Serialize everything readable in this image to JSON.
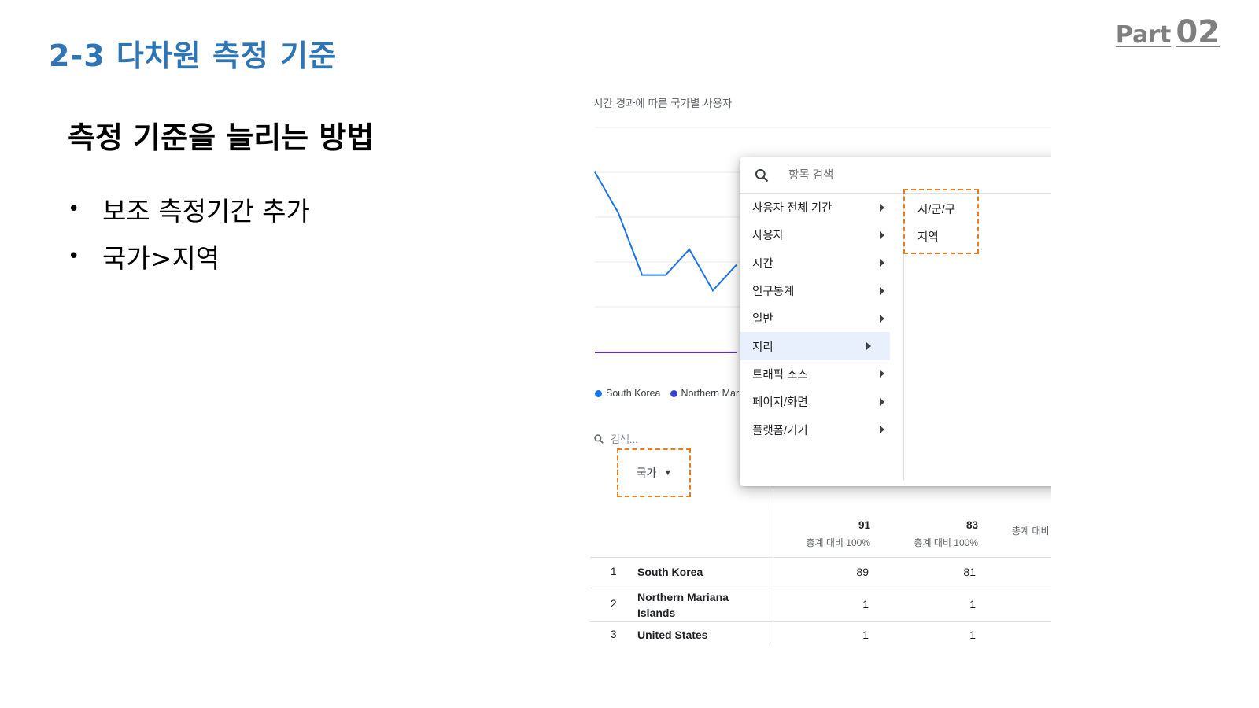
{
  "slide": {
    "title": "2-3 다차원 측정 기준",
    "part_word": "Part",
    "part_number": "02",
    "subheading": "측정 기준을 늘리는 방법",
    "bullet_marker": "•",
    "bullets": [
      "보조 측정기간 추가",
      "국가>지역"
    ]
  },
  "screenshot": {
    "chart_title": "시간 경과에 따른 국가별 사용자",
    "chart_data": {
      "type": "line",
      "title": "시간 경과에 따른 국가별 사용자",
      "series": [
        {
          "name": "South Korea",
          "color": "#1a73e8",
          "values": [
            35,
            27,
            15,
            15,
            20,
            12,
            17
          ]
        },
        {
          "name": "Northern Mariana Islands",
          "color": "#5e35b1",
          "values": [
            0,
            0,
            0,
            0,
            0,
            0,
            0
          ]
        }
      ],
      "grid": true
    },
    "legend": [
      {
        "label": "South Korea",
        "color": "#1a73e8"
      },
      {
        "label": "Northern Mar",
        "color": "#3c3fd6"
      }
    ],
    "table": {
      "search_placeholder": "검색...",
      "dimension_header": "국가",
      "totals": [
        {
          "value": "91",
          "sub": "총계 대비 100%"
        },
        {
          "value": "83",
          "sub": "총계 대비 100%"
        },
        {
          "value": "",
          "sub": "총계 대비"
        }
      ],
      "rows": [
        {
          "index": "1",
          "country": "South Korea",
          "v1": "89",
          "v2": "81"
        },
        {
          "index": "2",
          "country": "Northern Mariana Islands",
          "v1": "1",
          "v2": "1"
        },
        {
          "index": "3",
          "country": "United States",
          "v1": "1",
          "v2": "1"
        }
      ]
    },
    "dropdown": {
      "search_placeholder": "항목 검색",
      "categories": [
        "사용자 전체 기간",
        "사용자",
        "시간",
        "인구통계",
        "일반",
        "지리",
        "트래픽 소스",
        "페이지/화면",
        "플랫폼/기기"
      ],
      "active_category": "지리",
      "subitems": [
        "시/군/구",
        "지역"
      ]
    },
    "highlight_color": "#e67e22"
  }
}
